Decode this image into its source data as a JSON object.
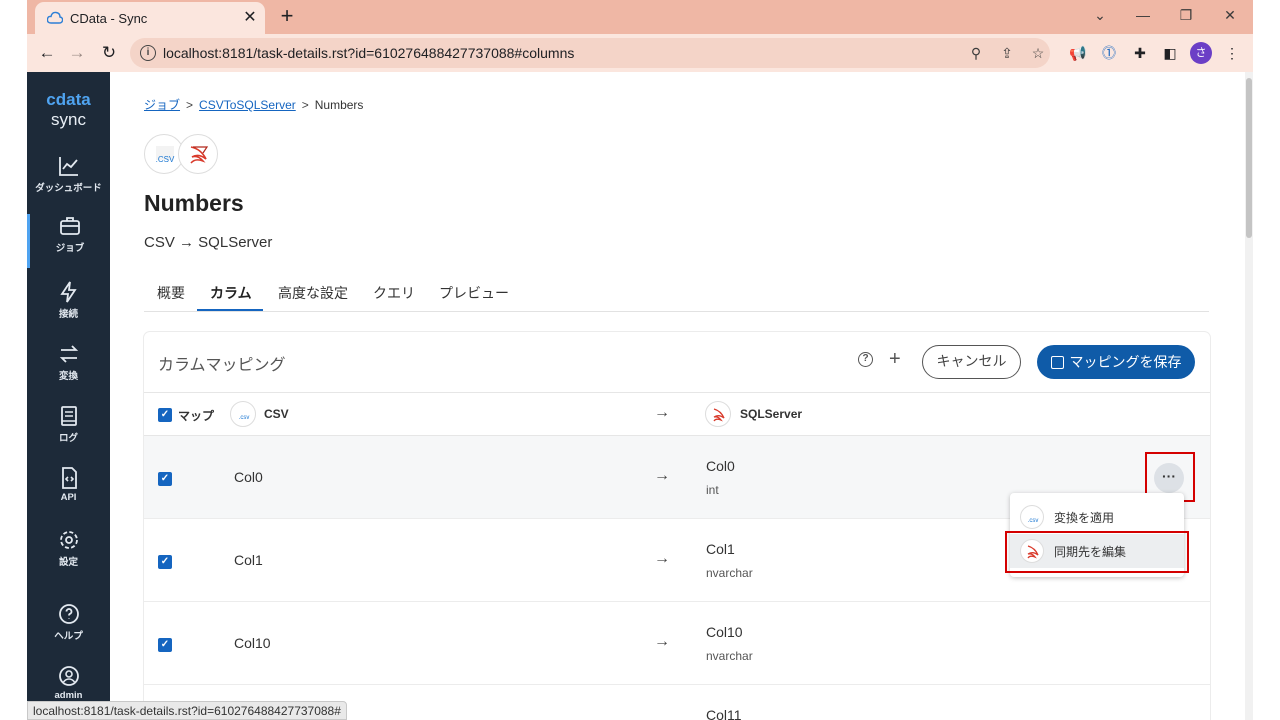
{
  "browser": {
    "tab_title": "CData - Sync",
    "tab_close": "✕",
    "new_tab": "+",
    "url": "localhost:8181/task-details.rst?id=610276488427737088#columns",
    "status_url": "localhost:8181/task-details.rst?id=610276488427737088#",
    "profile_initial": "さ",
    "icons": [
      "back-icon",
      "forward-icon",
      "reload-icon",
      "info-icon",
      "zoom-icon",
      "share-icon",
      "star-icon",
      "megaphone-icon",
      "password-icon",
      "puzzle-icon",
      "sidepanel-icon",
      "profile-avatar",
      "kebab-icon"
    ]
  },
  "sidebar": {
    "logo_top": "cdata",
    "logo_bottom": "sync",
    "items": [
      {
        "label": "ダッシュボード",
        "icon": "chart-icon"
      },
      {
        "label": "ジョブ",
        "icon": "briefcase-icon"
      },
      {
        "label": "接続",
        "icon": "bolt-icon"
      },
      {
        "label": "変換",
        "icon": "swap-icon"
      },
      {
        "label": "ログ",
        "icon": "book-icon"
      },
      {
        "label": "API",
        "icon": "code-file-icon"
      },
      {
        "label": "設定",
        "icon": "gear-icon"
      },
      {
        "label": "ヘルプ",
        "icon": "help-icon"
      },
      {
        "label": "admin",
        "icon": "user-icon"
      }
    ]
  },
  "breadcrumb": {
    "item1": "ジョブ",
    "item2": "CSVToSQLServer",
    "current": "Numbers",
    "sep": ">"
  },
  "page": {
    "title": "Numbers",
    "subtitle": "CSV → SQLServer",
    "csv_badge": ".CSV"
  },
  "tabs": [
    "概要",
    "カラム",
    "高度な設定",
    "クエリ",
    "プレビュー"
  ],
  "card": {
    "title": "カラムマッピング",
    "help": "?",
    "add": "+",
    "cancel_label": "キャンセル",
    "save_label": "マッピングを保存",
    "header": {
      "map_label": "マップ",
      "source_label": "CSV",
      "dest_label": "SQLServer",
      "arrow": "→",
      "csv_mini": ".csv"
    },
    "rows": [
      {
        "source": "Col0",
        "dest": "Col0",
        "type": "int",
        "arrow": "→",
        "check": "✓"
      },
      {
        "source": "Col1",
        "dest": "Col1",
        "type": "nvarchar",
        "arrow": "→",
        "check": "✓"
      },
      {
        "source": "Col10",
        "dest": "Col10",
        "type": "nvarchar",
        "arrow": "→",
        "check": "✓"
      },
      {
        "source": "",
        "dest": "Col11",
        "type": "",
        "arrow": "→",
        "check": "✓"
      }
    ],
    "more": "···"
  },
  "menu": {
    "items": [
      {
        "label": "変換を適用",
        "icon_text": ".csv"
      },
      {
        "label": "同期先を編集"
      }
    ]
  },
  "colors": {
    "tabstrip": "#efb7a5",
    "toolbar": "#fbe6de",
    "sidebar": "#1d2a39",
    "accent": "#1565c0",
    "save_button": "#0f5ba8",
    "highlight_box": "#d40000"
  }
}
